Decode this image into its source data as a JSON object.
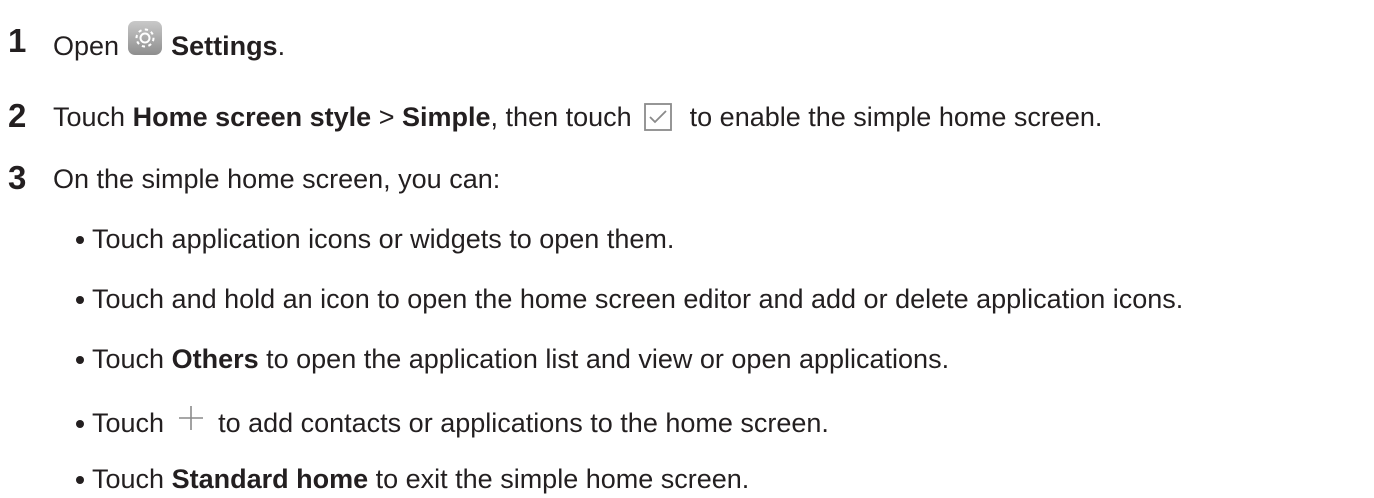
{
  "steps": [
    {
      "number": "1",
      "parts": {
        "pre": "Open",
        "bold": "Settings",
        "post": "."
      },
      "icon": "settings-gear-icon"
    },
    {
      "number": "2",
      "parts": {
        "pre": "Touch",
        "bold1": "Home screen style",
        "mid1": ">",
        "bold2": "Simple",
        "mid2": ", then touch",
        "post": "to enable the simple home screen."
      },
      "icon": "checkbox-checked-icon"
    },
    {
      "number": "3",
      "text": "On the simple home screen, you can:"
    }
  ],
  "bullets": [
    {
      "text": "Touch application icons or widgets to open them."
    },
    {
      "text": "Touch and hold an icon to open the home screen editor and add or delete application icons."
    },
    {
      "pre": "Touch",
      "bold": "Others",
      "post": "to open the application list and view or open applications."
    },
    {
      "pre": "Touch",
      "post": "to add contacts or applications to the home screen.",
      "icon": "plus-icon"
    },
    {
      "pre": "Touch",
      "bold": "Standard home",
      "post": "to exit the simple home screen."
    }
  ],
  "colors": {
    "text": "#231f20",
    "icon_gray": "#8a8a8a",
    "gear_bg": "#a9a9a9"
  }
}
